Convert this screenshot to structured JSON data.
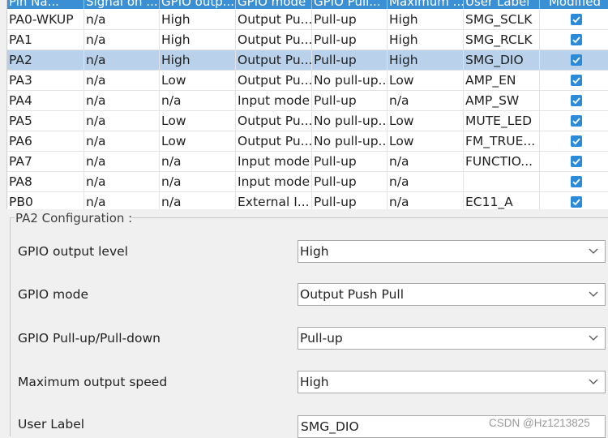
{
  "table": {
    "columns": [
      "Pin Na...",
      "Signal on ...",
      "GPIO outp...",
      "GPIO mode",
      "GPIO Pull...",
      "Maximum ...",
      "User Label",
      "Modified"
    ],
    "rows": [
      {
        "pin": "PA0-WKUP",
        "signal": "n/a",
        "output": "High",
        "mode": "Output Pu...",
        "pull": "Pull-up",
        "speed": "High",
        "label": "SMG_SCLK",
        "modified": true
      },
      {
        "pin": "PA1",
        "signal": "n/a",
        "output": "High",
        "mode": "Output Pu...",
        "pull": "Pull-up",
        "speed": "High",
        "label": "SMG_RCLK",
        "modified": true
      },
      {
        "pin": "PA2",
        "signal": "n/a",
        "output": "High",
        "mode": "Output Pu...",
        "pull": "Pull-up",
        "speed": "High",
        "label": "SMG_DIO",
        "modified": true
      },
      {
        "pin": "PA3",
        "signal": "n/a",
        "output": "Low",
        "mode": "Output Pu...",
        "pull": "No pull-up...",
        "speed": "Low",
        "label": "AMP_EN",
        "modified": true
      },
      {
        "pin": "PA4",
        "signal": "n/a",
        "output": "n/a",
        "mode": "Input mode",
        "pull": "Pull-up",
        "speed": "n/a",
        "label": "AMP_SW",
        "modified": true
      },
      {
        "pin": "PA5",
        "signal": "n/a",
        "output": "Low",
        "mode": "Output Pu...",
        "pull": "No pull-up...",
        "speed": "Low",
        "label": "MUTE_LED",
        "modified": true
      },
      {
        "pin": "PA6",
        "signal": "n/a",
        "output": "Low",
        "mode": "Output Pu...",
        "pull": "No pull-up...",
        "speed": "Low",
        "label": "FM_TRUE...",
        "modified": true
      },
      {
        "pin": "PA7",
        "signal": "n/a",
        "output": "n/a",
        "mode": "Input mode",
        "pull": "Pull-up",
        "speed": "n/a",
        "label": "FUNCTIO...",
        "modified": true
      },
      {
        "pin": "PA8",
        "signal": "n/a",
        "output": "n/a",
        "mode": "Input mode",
        "pull": "Pull-up",
        "speed": "n/a",
        "label": "",
        "modified": true
      },
      {
        "pin": "PB0",
        "signal": "n/a",
        "output": "n/a",
        "mode": "External I...",
        "pull": "Pull-up",
        "speed": "n/a",
        "label": "EC11_A",
        "modified": true
      }
    ],
    "selected_index": 2
  },
  "config": {
    "title": "PA2 Configuration :",
    "fields": [
      {
        "label": "GPIO output level",
        "value": "High"
      },
      {
        "label": "GPIO mode",
        "value": "Output Push Pull"
      },
      {
        "label": "GPIO Pull-up/Pull-down",
        "value": "Pull-up"
      },
      {
        "label": "Maximum output speed",
        "value": "High"
      }
    ],
    "user_label": {
      "label": "User Label",
      "value": "SMG_DIO"
    }
  },
  "colors": {
    "header_bg": "#3b8fd4",
    "selected_row": "#b9d1ea",
    "checkbox": "#2b8bd9"
  },
  "icons": {
    "checkbox": "checkmark-icon",
    "dropdown": "chevron-down-icon"
  },
  "watermark": "CSDN @Hz1213825"
}
